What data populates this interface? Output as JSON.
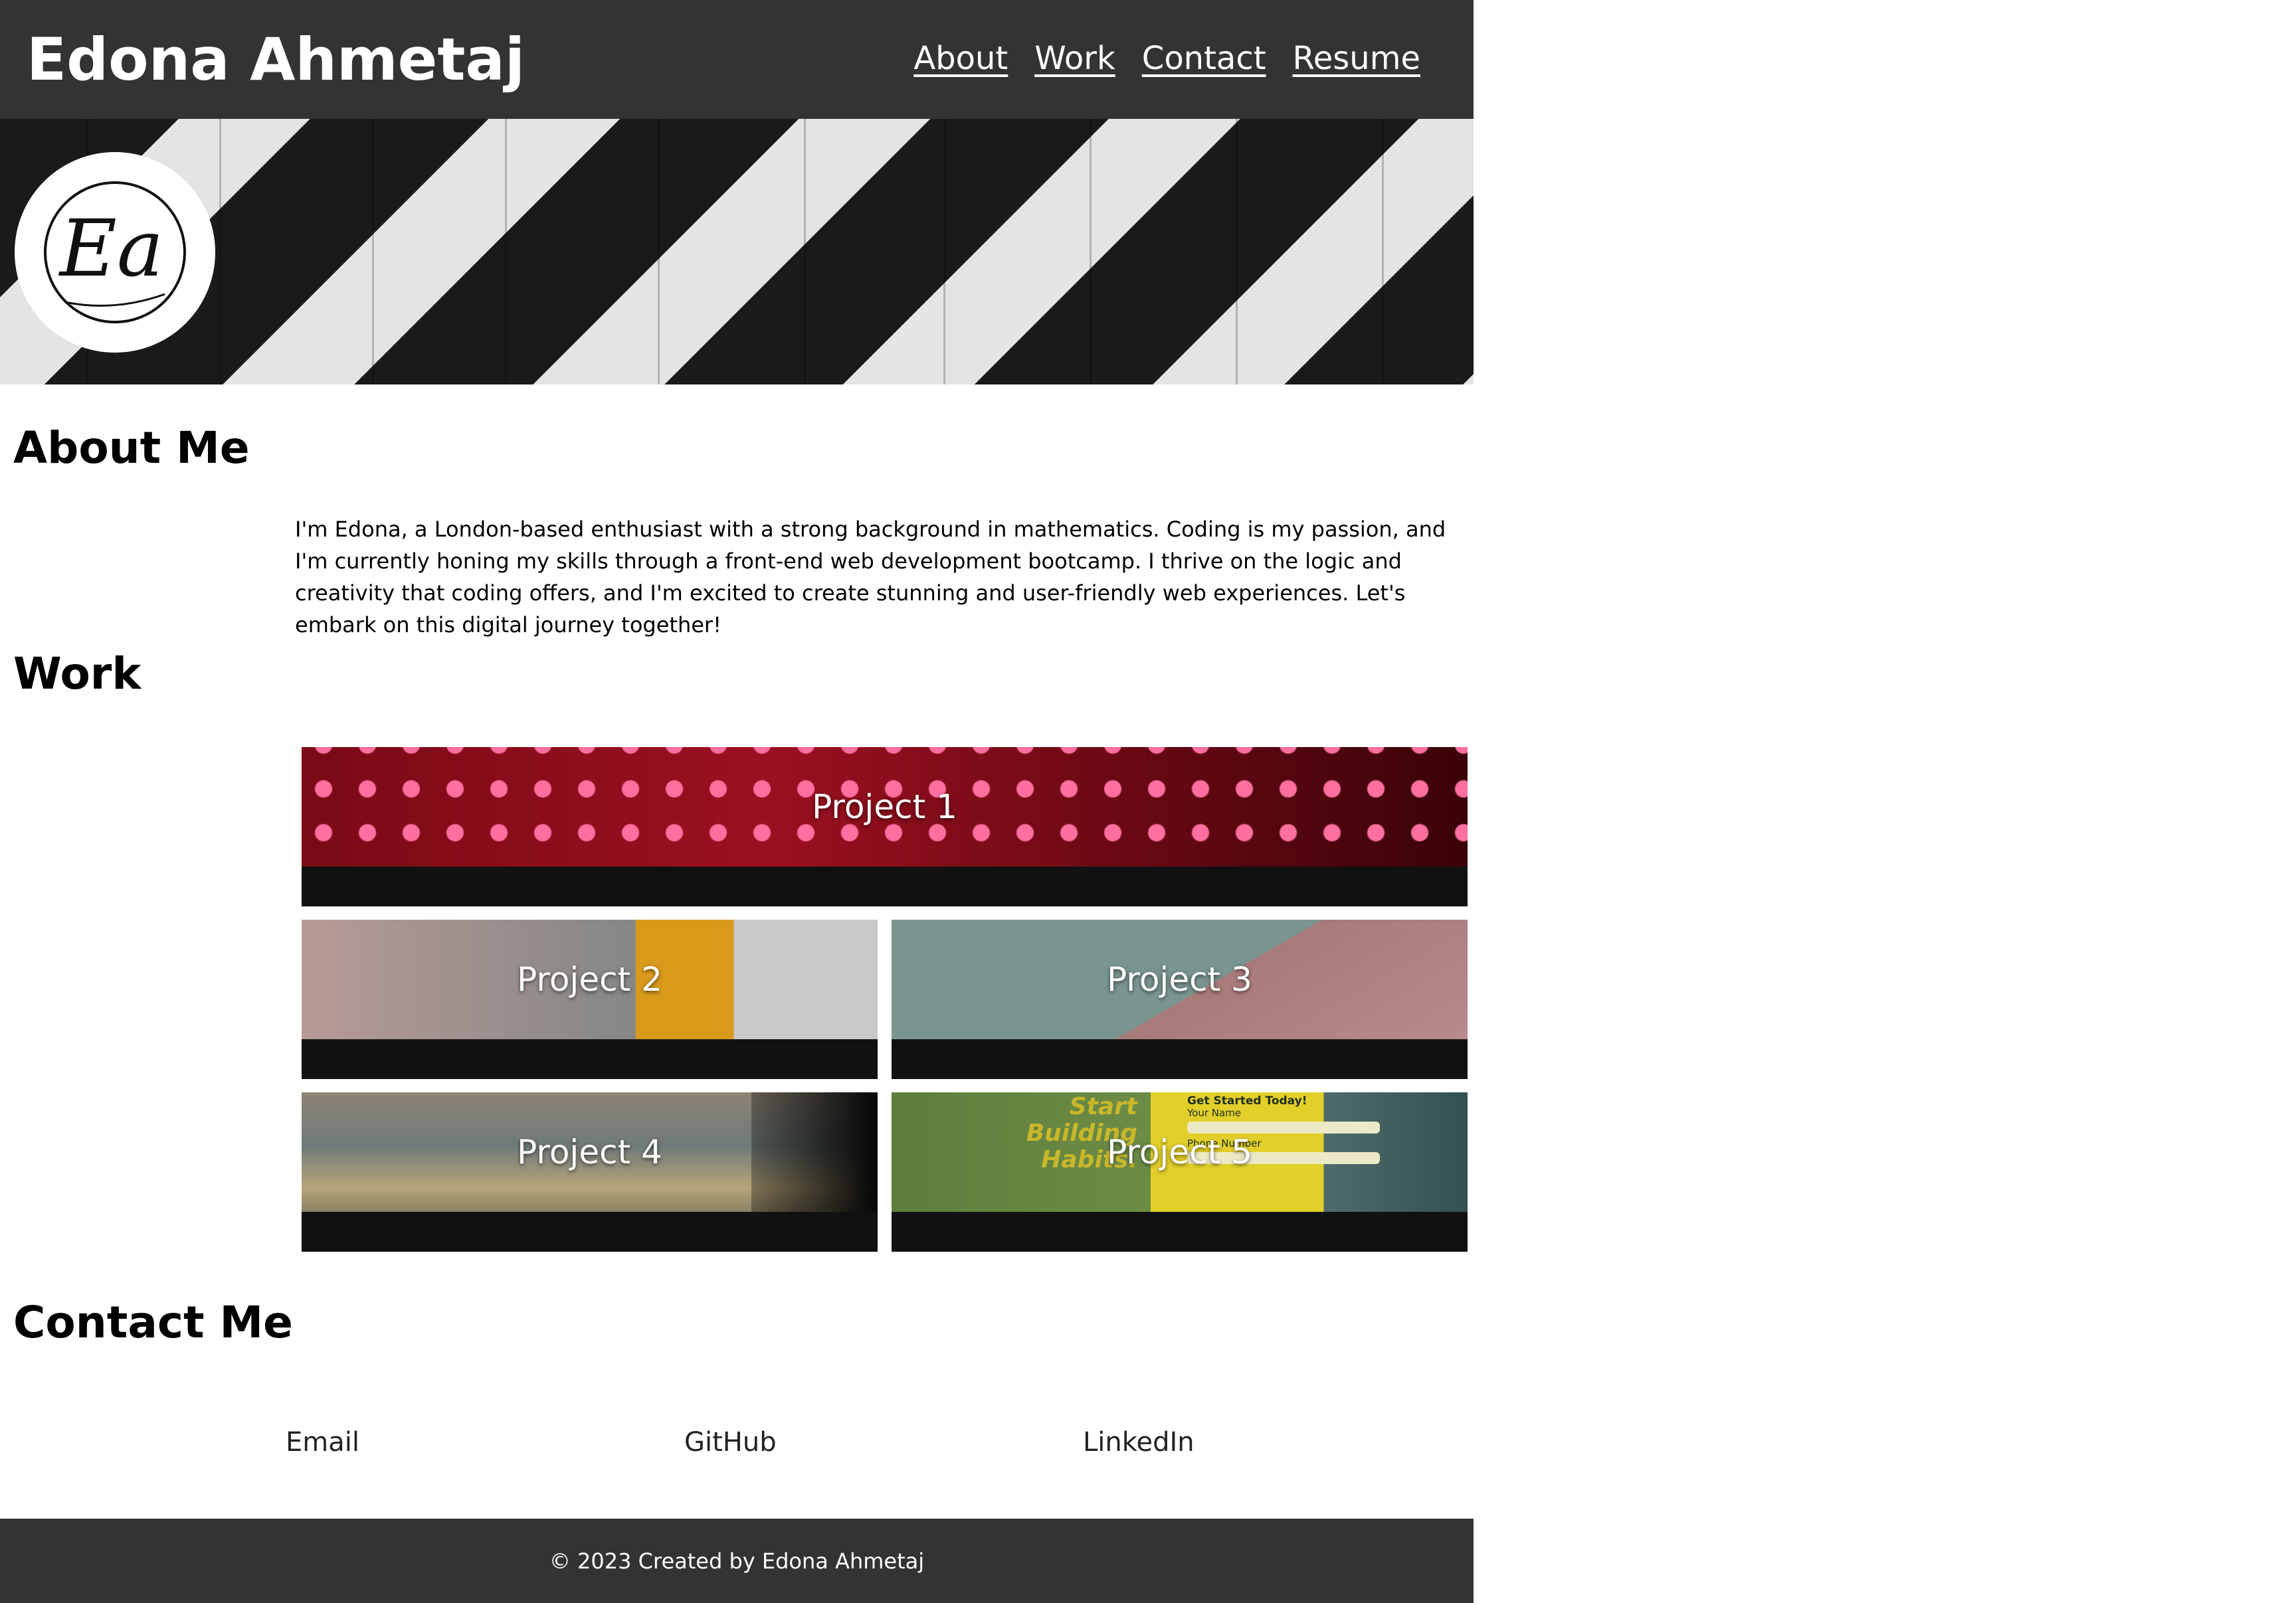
{
  "header": {
    "site_title": "Edona Ahmetaj",
    "nav": [
      "About",
      "Work",
      "Contact",
      "Resume"
    ]
  },
  "hero": {
    "logo_text": "Ea"
  },
  "about": {
    "heading": "About Me",
    "text": "I'm Edona, a London-based enthusiast with a strong background in mathematics. Coding is my passion, and I'm currently honing my skills through a front-end web development bootcamp. I thrive on the logic and creativity that coding offers, and I'm excited to create stunning and user-friendly web experiences. Let's embark on this digital journey together!"
  },
  "work": {
    "heading": "Work",
    "projects": [
      "Project 1",
      "Project 2",
      "Project 3",
      "Project 4",
      "Project 5"
    ],
    "project5_image": {
      "headline": "Start Building Habits.",
      "form_title": "Get Started Today!",
      "fields": [
        "Your Name",
        "Phone Number"
      ]
    }
  },
  "contact": {
    "heading": "Contact Me",
    "links": [
      "Email",
      "GitHub",
      "LinkedIn"
    ]
  },
  "footer": {
    "text": "© 2023 Created by Edona Ahmetaj"
  },
  "colors": {
    "header_bg": "#333333",
    "footer_bg": "#333333",
    "card_bg": "#111111"
  }
}
